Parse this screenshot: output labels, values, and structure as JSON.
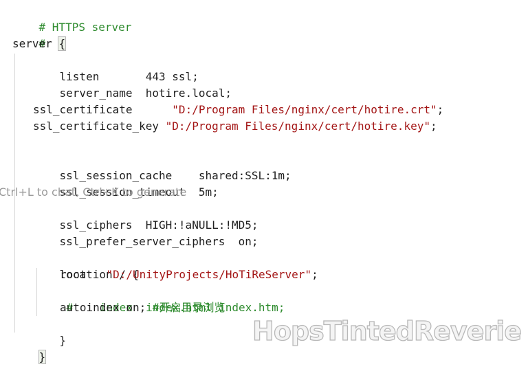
{
  "editor": {
    "colors": {
      "comment": "#2e8b2e",
      "string": "#a31515",
      "text": "#1f1f1f"
    },
    "lines": {
      "l1": "# HTTPS server",
      "l2": "#",
      "l3_kw": "server ",
      "l3_brace": "{",
      "l4": "listen       443 ssl;",
      "l5": "server_name  hotire.local;",
      "l7_a": "ssl_certificate      ",
      "l7_s": "\"D:/Program Files/nginx/cert/hotire.crt\"",
      "l7_e": ";",
      "l8_a": "ssl_certificate_key ",
      "l8_s": "\"D:/Program Files/nginx/cert/hotire.key\"",
      "l8_e": ";",
      "l10": "ssl_session_cache    shared:SSL:1m;",
      "l11": "ssl_session_timeout  5m;",
      "l13": "ssl_ciphers  HIGH:!aNULL:!MD5;",
      "l14": "ssl_prefer_server_ciphers  on;",
      "l16": "location / {",
      "l17_a": "root   ",
      "l17_s": "\"D:/UnityProjects/HoTiReServer\"",
      "l17_e": ";",
      "l18": "#    index  index.html index.htm;",
      "l19_a": "autoindex on; ",
      "l19_c": "#开启目录浏览",
      "l20": "}",
      "l21": "}"
    }
  },
  "hint": {
    "text": "Ctrl+L to chat, Ctrl+K to generate"
  },
  "watermark": {
    "text": "HopsTintedReverie"
  }
}
